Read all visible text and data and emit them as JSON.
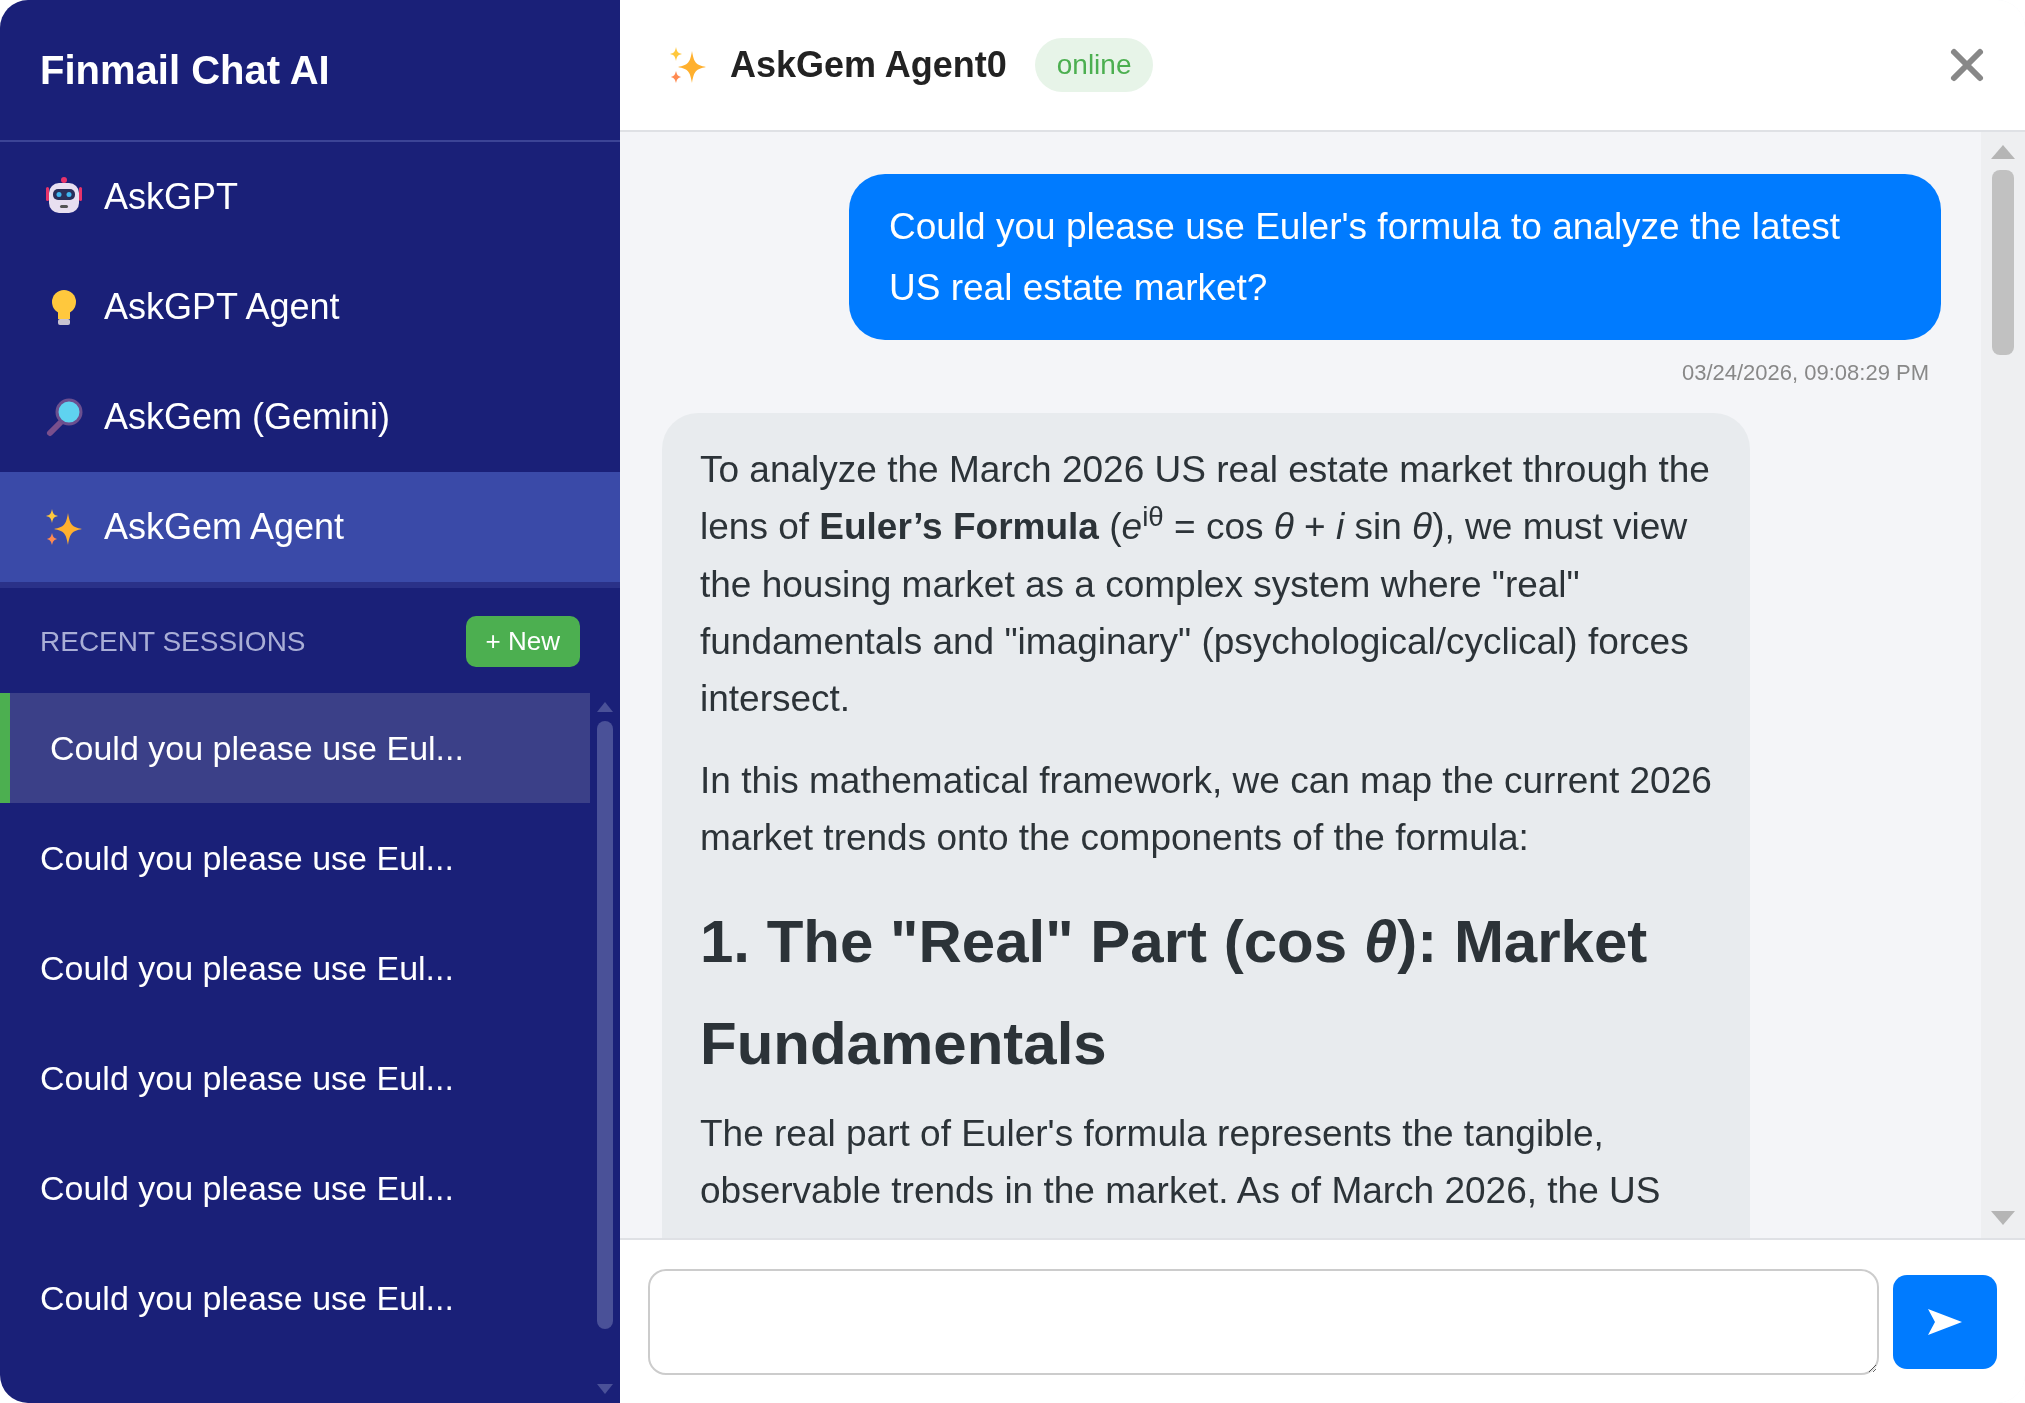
{
  "sidebar": {
    "title": "Finmail Chat AI",
    "items": [
      {
        "label": "AskGPT",
        "selected": false
      },
      {
        "label": "AskGPT Agent",
        "selected": false
      },
      {
        "label": "AskGem (Gemini)",
        "selected": false
      },
      {
        "label": "AskGem Agent",
        "selected": true
      }
    ],
    "sessions_heading": "RECENT SESSIONS",
    "new_button": "+ New",
    "sessions": [
      {
        "label": "Could you please use Eul...",
        "selected": true
      },
      {
        "label": "Could you please use Eul...",
        "selected": false
      },
      {
        "label": "Could you please use Eul...",
        "selected": false
      },
      {
        "label": "Could you please use Eul...",
        "selected": false
      },
      {
        "label": "Could you please use Eul...",
        "selected": false
      },
      {
        "label": "Could you please use Eul...",
        "selected": false
      }
    ]
  },
  "chat": {
    "title": "AskGem Agent0",
    "status": "online",
    "messages": [
      {
        "kind": "user",
        "text": "Could you please use Euler's formula to analyze the latest US real estate market?",
        "time": "03/24/2026, 09:08:29 PM"
      },
      {
        "kind": "assistant",
        "blocks": [
          {
            "kind": "paragraph",
            "text": "To analyze the March 2026 US real estate market through the lens of **Euler’s Formula** (*e*$^{iθ}$ = cos *θ* + *i* sin *θ*), we must view the housing market as a complex system where \"real\" fundamentals and \"imaginary\" (psychological/cyclical) forces intersect."
          },
          {
            "kind": "paragraph",
            "text": "In this mathematical framework, we can map the current 2026 market trends onto the components of the formula:"
          },
          {
            "kind": "heading",
            "text": "1. The \"Real\" Part (cos *θ*): Market Fundamentals"
          },
          {
            "kind": "paragraph",
            "text": "The real part of Euler's formula represents the tangible, observable trends in the market. As of March 2026, the US"
          }
        ]
      }
    ]
  }
}
